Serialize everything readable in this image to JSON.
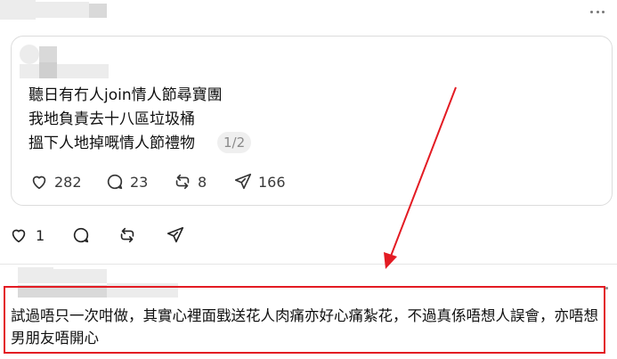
{
  "quote": {
    "lines": [
      "聽日有冇人join情人節尋寶團",
      "我地負責去十八區垃圾桶",
      "搵下人地掉嘅情人節禮物"
    ],
    "page_indicator": "1/2",
    "stats": {
      "likes": "282",
      "replies": "23",
      "reposts": "8",
      "shares": "166"
    }
  },
  "actions": {
    "likes": "1"
  },
  "reply": {
    "text": "試過唔只一次咁做，其實心裡面戥送花人肉痛亦好心痛紮花，不過真係唔想人誤會，亦唔想男朋友唔開心"
  },
  "colors": {
    "highlight": "#e31b23",
    "border": "#dcdcdc",
    "muted": "#8a8a8a"
  },
  "icons": [
    "more-horizontal-icon",
    "heart-icon",
    "comment-icon",
    "repost-icon",
    "share-icon",
    "red-arrow-annotation"
  ]
}
